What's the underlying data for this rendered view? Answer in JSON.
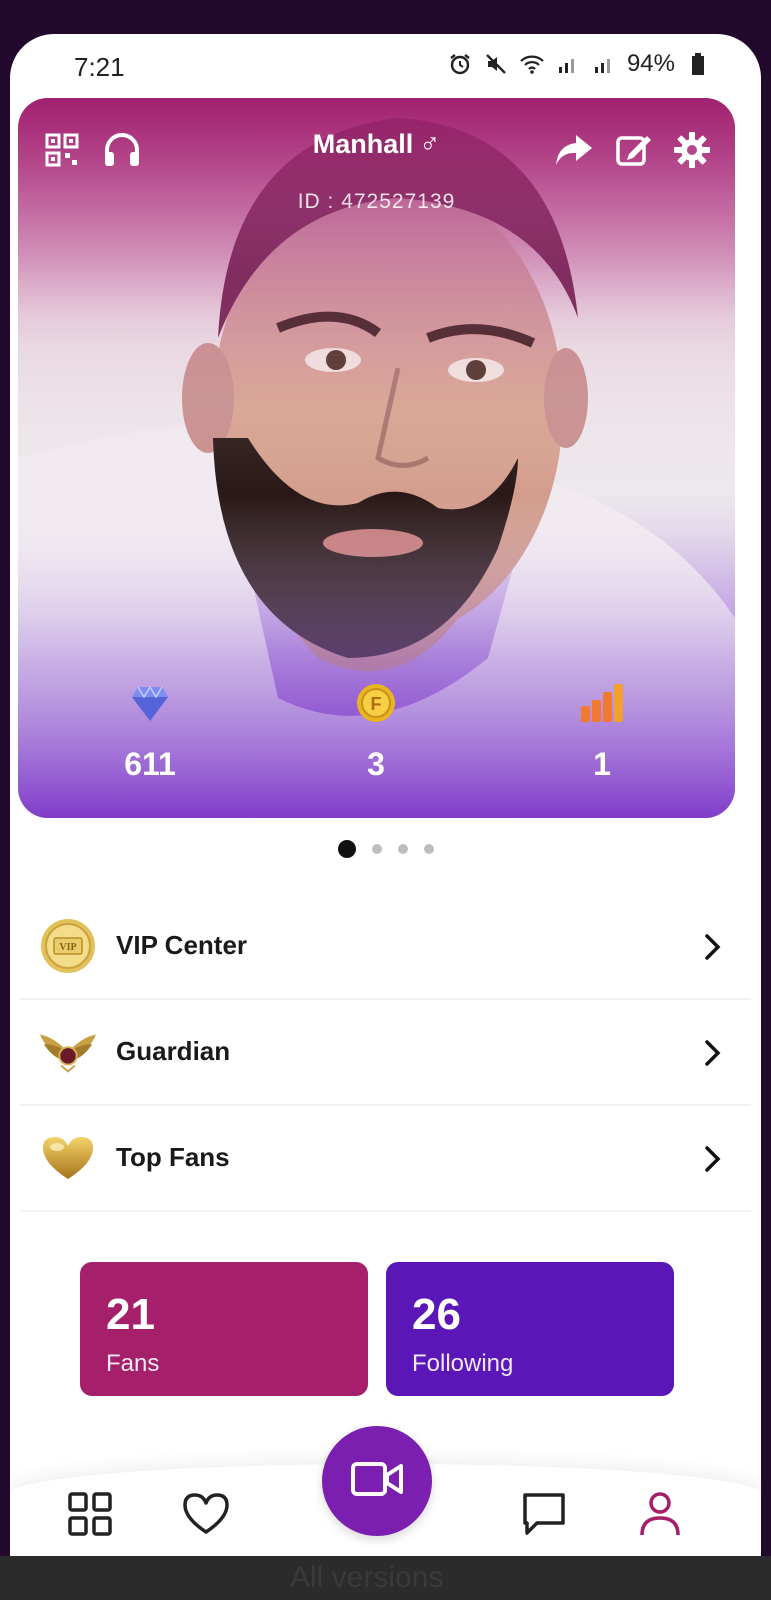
{
  "status_bar": {
    "time": "7:21",
    "battery": "94%",
    "icons": [
      "alarm-icon",
      "mute-icon",
      "wifi-icon",
      "signal-icon",
      "signal-icon",
      "battery-icon"
    ]
  },
  "profile": {
    "username": "Manhall",
    "gender_symbol": "♂",
    "id_text": "ID : 472527139",
    "toolbar_icons": [
      "qr-code-icon",
      "headset-icon",
      "share-icon",
      "edit-icon",
      "settings-icon"
    ],
    "stats": [
      {
        "icon": "diamond-icon",
        "value": "611"
      },
      {
        "icon": "coin-icon",
        "value": "3"
      },
      {
        "icon": "level-bars-icon",
        "value": "1"
      }
    ]
  },
  "pager": {
    "count": 4,
    "active": 0
  },
  "menu": [
    {
      "label": "VIP Center",
      "icon": "vip-badge-icon"
    },
    {
      "label": "Guardian",
      "icon": "guardian-wings-icon"
    },
    {
      "label": "Top Fans",
      "icon": "gold-heart-icon"
    }
  ],
  "counts": {
    "fans": {
      "value": "21",
      "label": "Fans"
    },
    "following": {
      "value": "26",
      "label": "Following"
    }
  },
  "nav": {
    "items": [
      "grid-icon",
      "heart-icon",
      "live-video-icon",
      "chat-icon",
      "profile-icon"
    ],
    "active": "profile-icon"
  },
  "footer_text": "All versions",
  "colors": {
    "fans_bg": "#a51f6b",
    "following_bg": "#5b16b8",
    "live_button": "#7a1fb0",
    "active_nav": "#a51f6b"
  }
}
